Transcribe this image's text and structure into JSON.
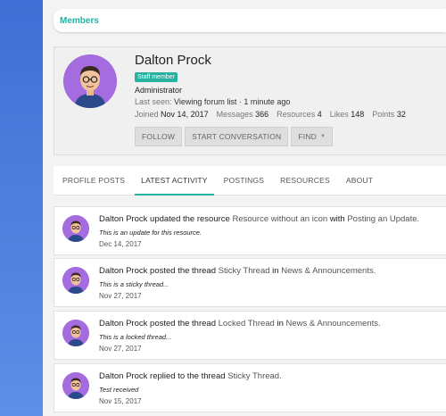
{
  "breadcrumb": {
    "label": "Members"
  },
  "profile": {
    "name": "Dalton Prock",
    "badge": "Staff member",
    "role": "Administrator",
    "last_seen_label": "Last seen:",
    "last_seen_value": "Viewing forum list · 1 minute ago",
    "stats": [
      {
        "label": "Joined",
        "value": "Nov 14, 2017"
      },
      {
        "label": "Messages",
        "value": "366"
      },
      {
        "label": "Resources",
        "value": "4"
      },
      {
        "label": "Likes",
        "value": "148"
      },
      {
        "label": "Points",
        "value": "32"
      }
    ],
    "buttons": {
      "follow": "FOLLOW",
      "conversation": "START CONVERSATION",
      "find": "FIND"
    }
  },
  "tabs": [
    {
      "label": "PROFILE POSTS"
    },
    {
      "label": "LATEST ACTIVITY"
    },
    {
      "label": "POSTINGS"
    },
    {
      "label": "RESOURCES"
    },
    {
      "label": "ABOUT"
    }
  ],
  "activity": [
    {
      "user": "Dalton Prock",
      "action": "updated the resource",
      "target": "Resource without an icon",
      "joiner": "with",
      "target2": "Posting an Update.",
      "snippet": "This is an update for this resource.",
      "date": "Dec 14, 2017"
    },
    {
      "user": "Dalton Prock",
      "action": "posted the thread",
      "target": "Sticky Thread",
      "joiner": "in",
      "target2": "News & Announcements.",
      "snippet": "This is a sticky thread...",
      "date": "Nov 27, 2017"
    },
    {
      "user": "Dalton Prock",
      "action": "posted the thread",
      "target": "Locked Thread",
      "joiner": "in",
      "target2": "News & Announcements.",
      "snippet": "This is a locked thread...",
      "date": "Nov 27, 2017"
    },
    {
      "user": "Dalton Prock",
      "action": "replied to the thread",
      "target": "Sticky Thread.",
      "joiner": "",
      "target2": "",
      "snippet": "Test received",
      "date": "Nov 15, 2017"
    }
  ],
  "colors": {
    "accent": "#27b1a0",
    "avatar_bg": "#a56ce0",
    "background": "#4f7fe0"
  }
}
